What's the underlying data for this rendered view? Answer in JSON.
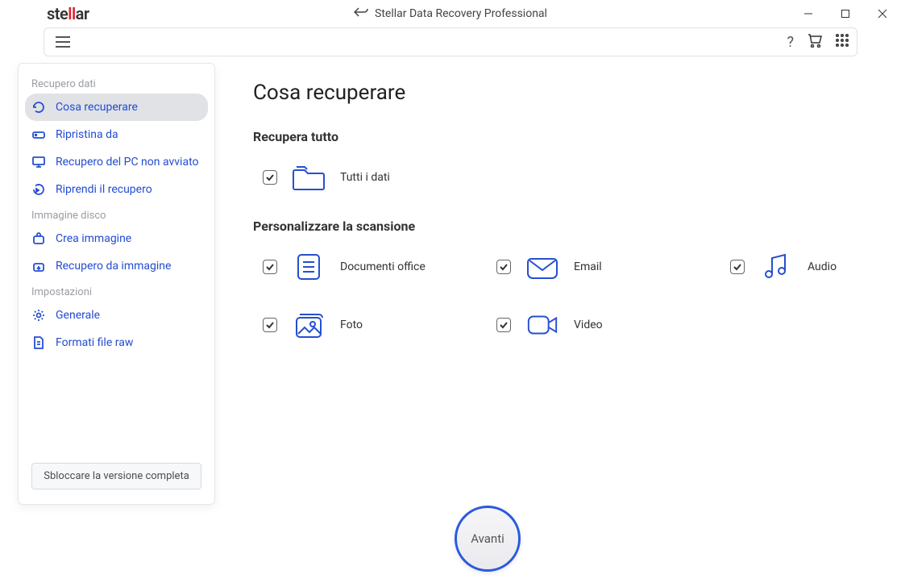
{
  "app": {
    "logo_st": "ste",
    "logo_el": "ll",
    "logo_ar": "ar",
    "title": "Stellar Data Recovery Professional"
  },
  "sidebar": {
    "groups": [
      {
        "header": "Recupero dati",
        "items": [
          "Cosa recuperare",
          "Ripristina da",
          "Recupero del PC non avviato",
          "Riprendi il recupero"
        ]
      },
      {
        "header": "Immagine disco",
        "items": [
          "Crea immagine",
          "Recupero da immagine"
        ]
      },
      {
        "header": "Impostazioni",
        "items": [
          "Generale",
          "Formati file raw"
        ]
      }
    ],
    "unlock": "Sbloccare la versione completa"
  },
  "main": {
    "page_title": "Cosa recuperare",
    "section_all": "Recupera tutto",
    "all_data": "Tutti i dati",
    "section_custom": "Personalizzare la scansione",
    "options": {
      "office": "Documenti office",
      "email": "Email",
      "audio": "Audio",
      "photo": "Foto",
      "video": "Video"
    },
    "next": "Avanti"
  }
}
